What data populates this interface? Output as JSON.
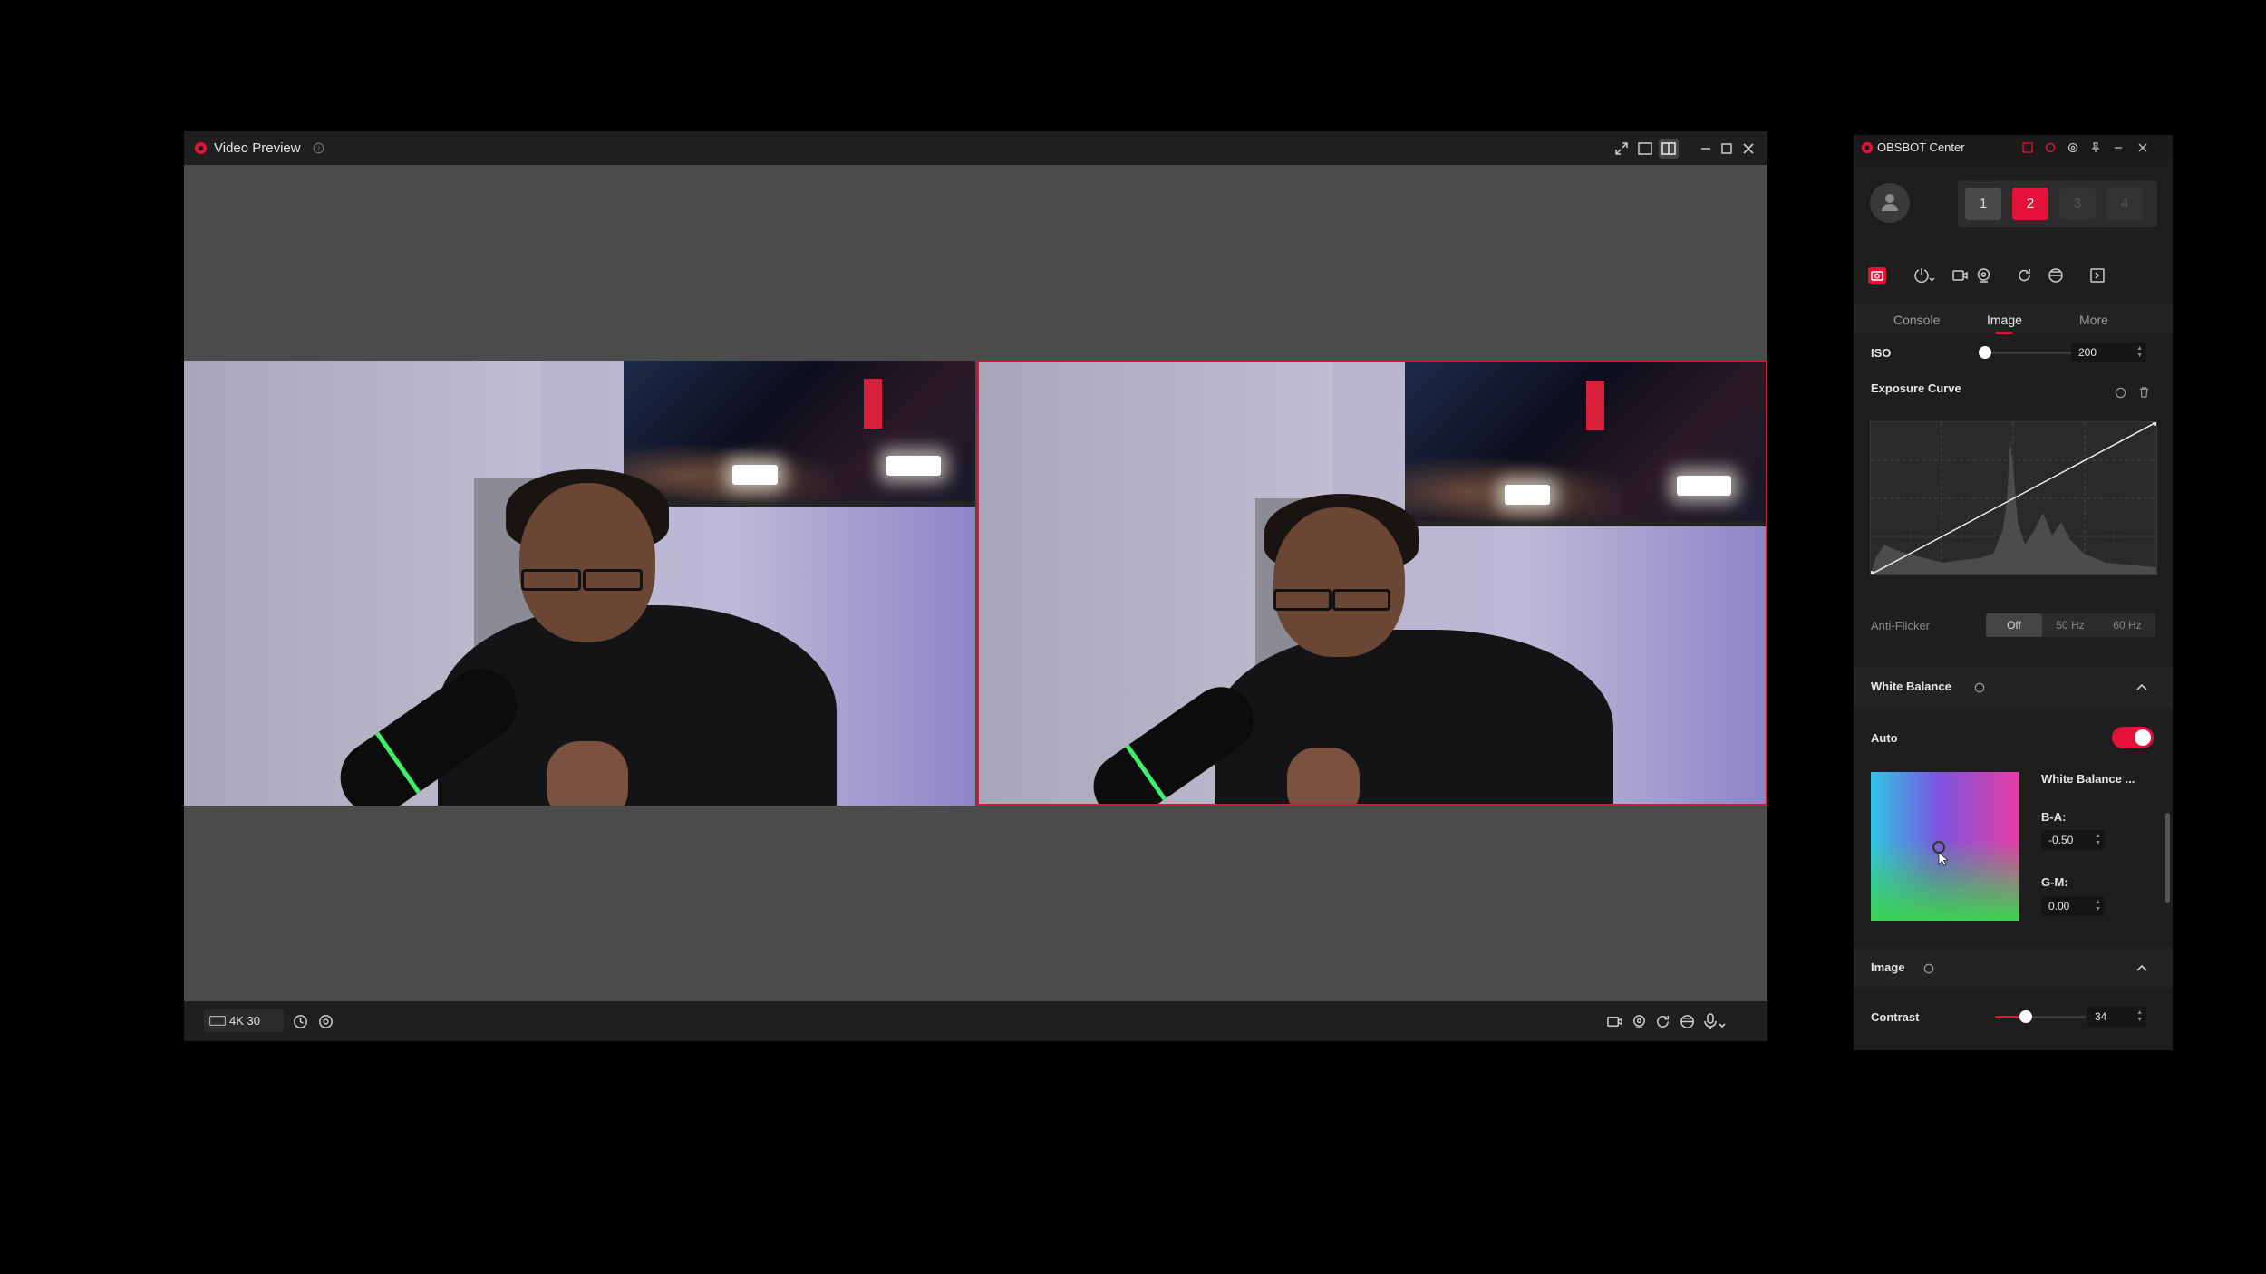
{
  "video_preview": {
    "title": "Video Preview",
    "resolution_icon": "hd-icon",
    "resolution": "4K 30"
  },
  "obsbot": {
    "title": "OBSBOT Center",
    "devices": [
      "1",
      "2",
      "3",
      "4"
    ],
    "active_device": "2",
    "tabs": [
      "Console",
      "Image",
      "More"
    ],
    "active_tab": "Image",
    "iso": {
      "label": "ISO",
      "value": "200"
    },
    "exposure_curve": {
      "label": "Exposure Curve"
    },
    "anti_flicker": {
      "label": "Anti-Flicker",
      "options": [
        "Off",
        "50 Hz",
        "60 Hz"
      ],
      "selected": "Off"
    },
    "white_balance": {
      "title": "White Balance",
      "auto_label": "Auto",
      "auto_on": true,
      "mode_label": "White Balance ...",
      "ba_label": "B-A:",
      "ba_value": "-0.50",
      "gm_label": "G-M:",
      "gm_value": "0.00"
    },
    "image_section": {
      "title": "Image"
    },
    "contrast": {
      "label": "Contrast",
      "value": "34"
    }
  },
  "colors": {
    "accent": "#e4123b",
    "window_bg": "#1e1e1e",
    "preview_bg": "#4b4b4b"
  }
}
